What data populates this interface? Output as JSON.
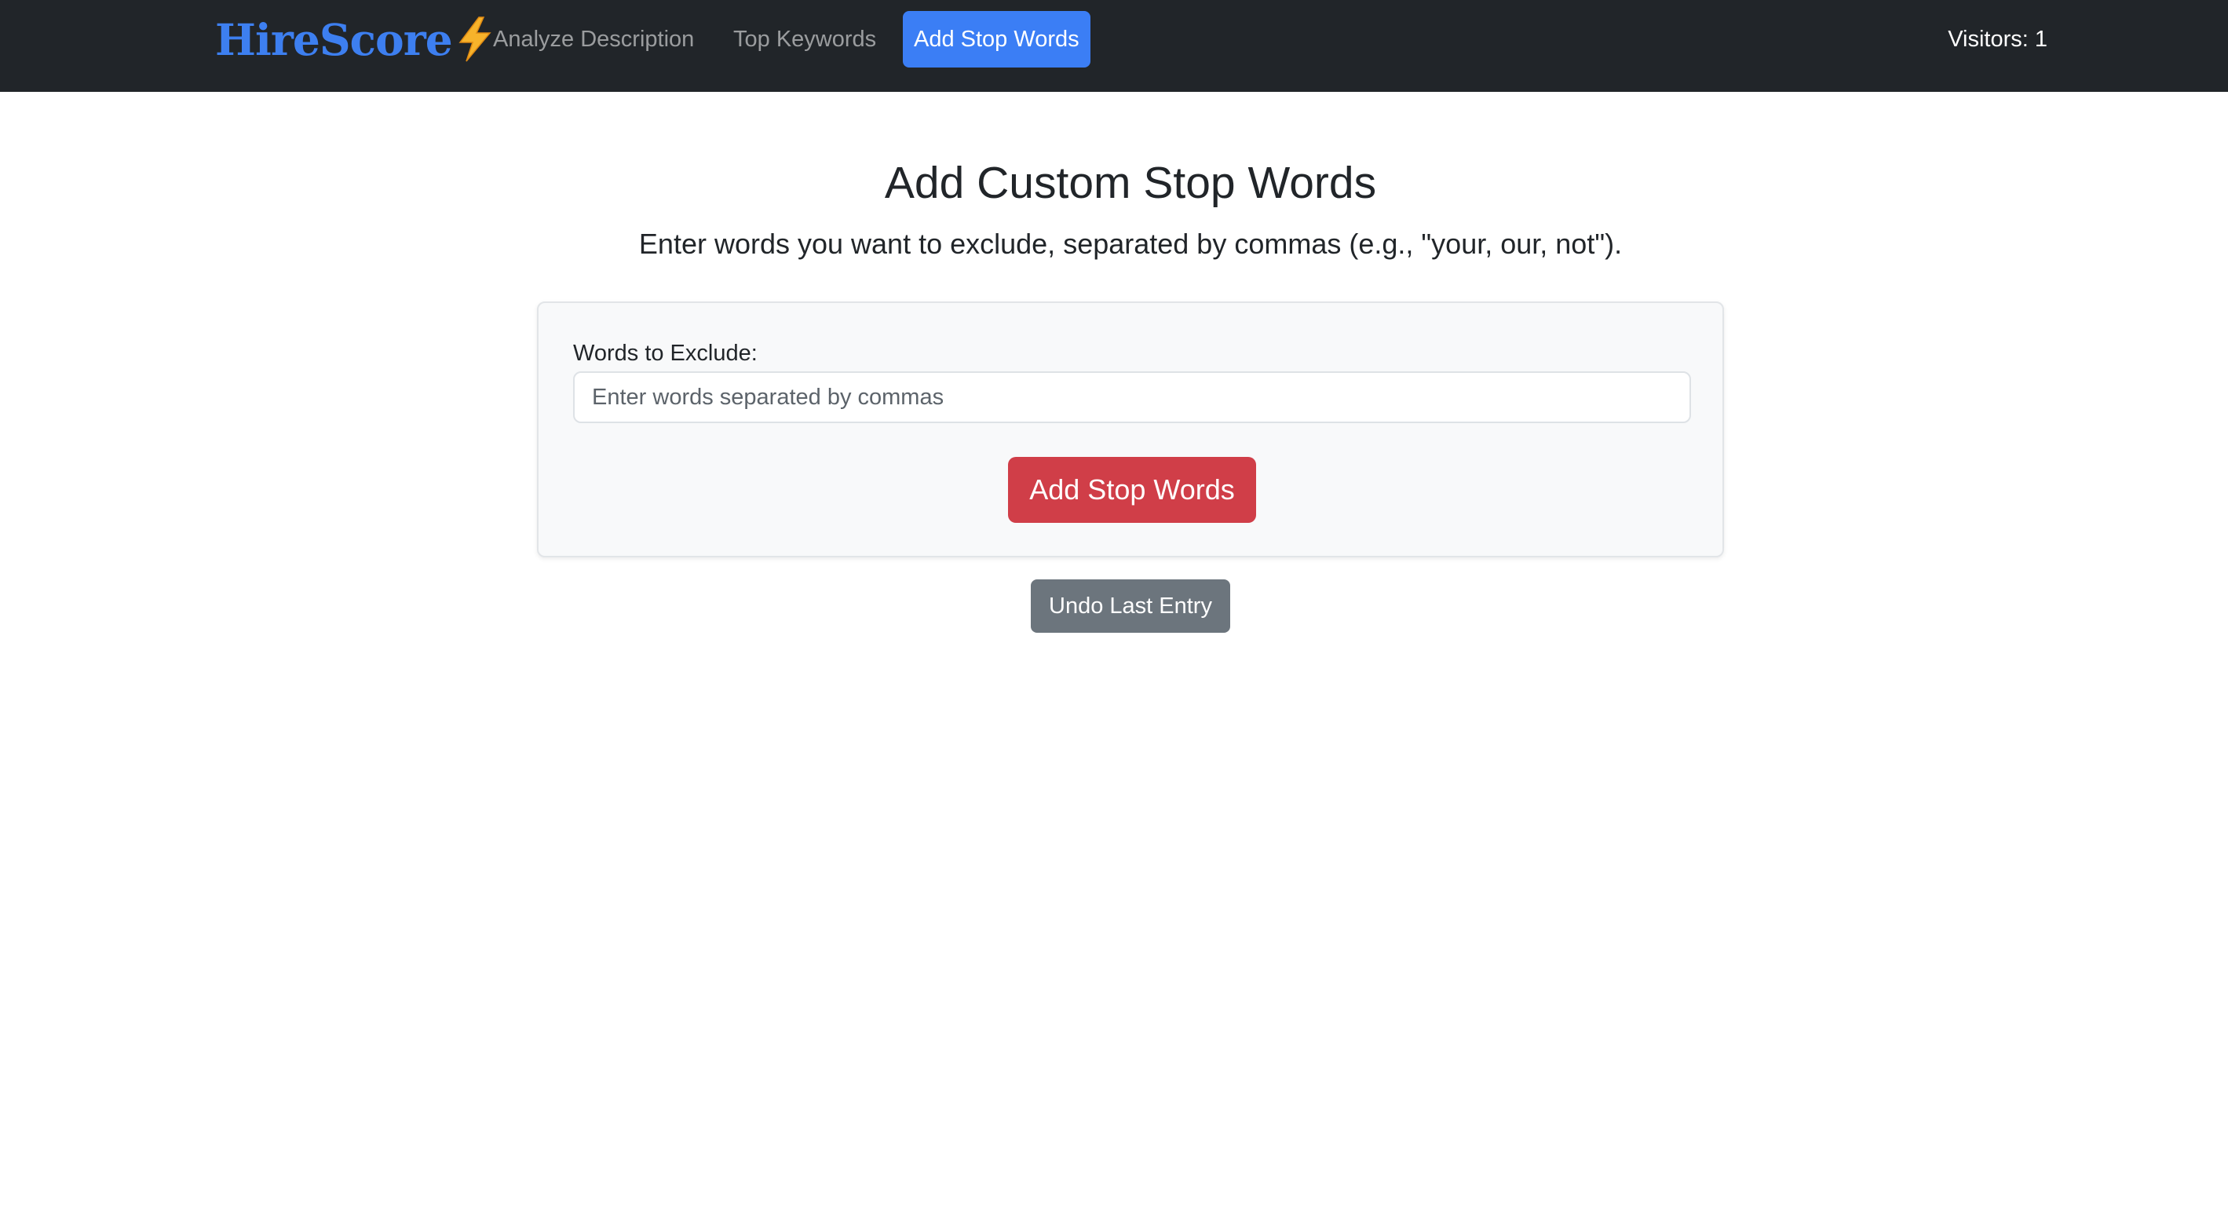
{
  "navbar": {
    "brand": "HireScore",
    "brand_icon": "lightning-bolt-icon",
    "links": [
      {
        "label": "Analyze Description",
        "active": false
      },
      {
        "label": "Top Keywords",
        "active": false
      },
      {
        "label": "Add Stop Words",
        "active": true
      }
    ],
    "visitors": "Visitors: 1"
  },
  "main": {
    "title": "Add Custom Stop Words",
    "subtitle": "Enter words you want to exclude, separated by commas (e.g., \"your, our, not\").",
    "form": {
      "label": "Words to Exclude:",
      "input_value": "",
      "input_placeholder": "Enter words separated by commas",
      "submit_label": "Add Stop Words"
    },
    "undo_label": "Undo Last Entry"
  },
  "colors": {
    "navbar_bg": "#212529",
    "brand": "#3d7ff0",
    "active_link_bg": "#3b7ef5",
    "submit_bg": "#d03e48",
    "undo_bg": "#6c757d",
    "card_bg": "#f8f9fa"
  }
}
